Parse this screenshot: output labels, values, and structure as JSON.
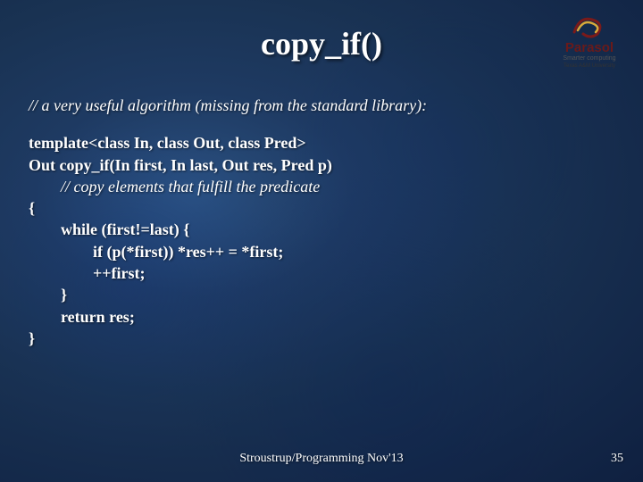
{
  "title": "copy_if()",
  "logo": {
    "brand": "Parasol",
    "tagline": "Smarter computing",
    "university": "Texas A&M University"
  },
  "comment_top": "// a very useful algorithm (missing from the standard library):",
  "code": {
    "l1": "template<class In, class Out, class Pred>",
    "l2": "Out copy_if(In first, In last, Out res, Pred p)",
    "l3": "        // copy elements that fulfill the predicate",
    "l4": "{",
    "l5": "        while (first!=last) {",
    "l6": "                if (p(*first)) *res++ = *first;",
    "l7": "                ++first;",
    "l8": "        }",
    "l9": "        return res;",
    "l10": "}"
  },
  "footer": "Stroustrup/Programming Nov'13",
  "page_number": "35"
}
